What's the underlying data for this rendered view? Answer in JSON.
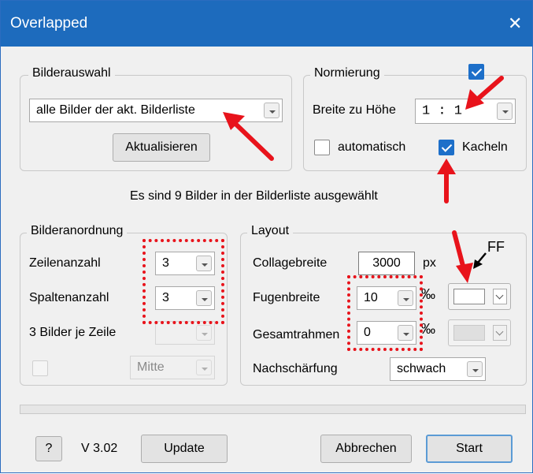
{
  "window": {
    "title": "Overlapped",
    "close_glyph": "✕"
  },
  "bilderauswahl": {
    "legend": "Bilderauswahl",
    "combo_value": "alle Bilder der akt. Bilderliste",
    "button": "Aktualisieren"
  },
  "normierung": {
    "legend": "Normierung",
    "enabled": true,
    "ratio_label": "Breite zu Höhe",
    "ratio_value": "1 :  1",
    "auto_label": "automatisch",
    "auto_checked": false,
    "kacheln_label": "Kacheln",
    "kacheln_checked": true
  },
  "status_text": "Es sind 9 Bilder in der Bilderliste ausgewählt",
  "anordnung": {
    "legend": "Bilderanordnung",
    "rows_label": "Zeilenanzahl",
    "rows_value": "3",
    "cols_label": "Spaltenanzahl",
    "cols_value": "3",
    "per_row_label": "3 Bilder je Zeile",
    "per_row_value": "",
    "align_value": "Mitte"
  },
  "layout": {
    "legend": "Layout",
    "width_label": "Collagebreite",
    "width_value": "3000",
    "width_unit": "px",
    "fugen_label": "Fugenbreite",
    "fugen_value": "10",
    "permille": "‰",
    "rahmen_label": "Gesamtrahmen",
    "rahmen_value": "0",
    "sharpen_label": "Nachschärfung",
    "sharpen_value": "schwach"
  },
  "annotation_text": "FF",
  "footer": {
    "help": "?",
    "version": "V 3.02",
    "update": "Update",
    "cancel": "Abbrechen",
    "start": "Start"
  },
  "colors": {
    "titlebar": "#1d6bbd",
    "accent": "#1d6fc9",
    "annotation": "#e8131b"
  }
}
